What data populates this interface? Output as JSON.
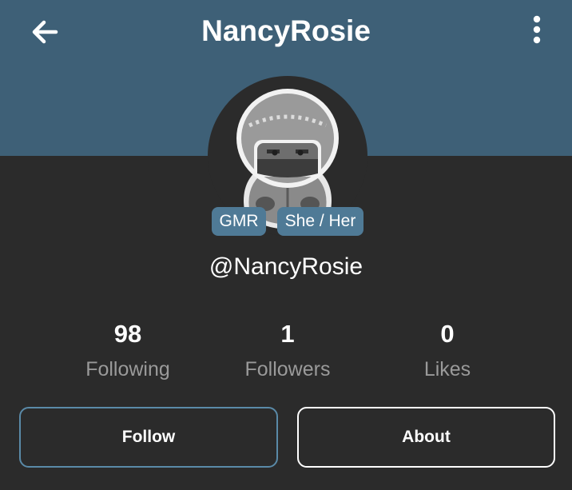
{
  "header": {
    "title": "NancyRosie",
    "back_icon": "arrow-left-icon",
    "more_icon": "more-vertical-icon",
    "background_color": "#3e6077"
  },
  "profile": {
    "avatar_icon": "hooded-character-avatar",
    "badges": [
      "GMR",
      "She / Her"
    ],
    "handle": "@NancyRosie",
    "badge_color": "#4f7a96"
  },
  "stats": [
    {
      "value": "98",
      "label": "Following"
    },
    {
      "value": "1",
      "label": "Followers"
    },
    {
      "value": "0",
      "label": "Likes"
    }
  ],
  "actions": {
    "follow_label": "Follow",
    "about_label": "About",
    "follow_border_color": "#5a8aa8"
  },
  "background_color": "#2b2b2b"
}
